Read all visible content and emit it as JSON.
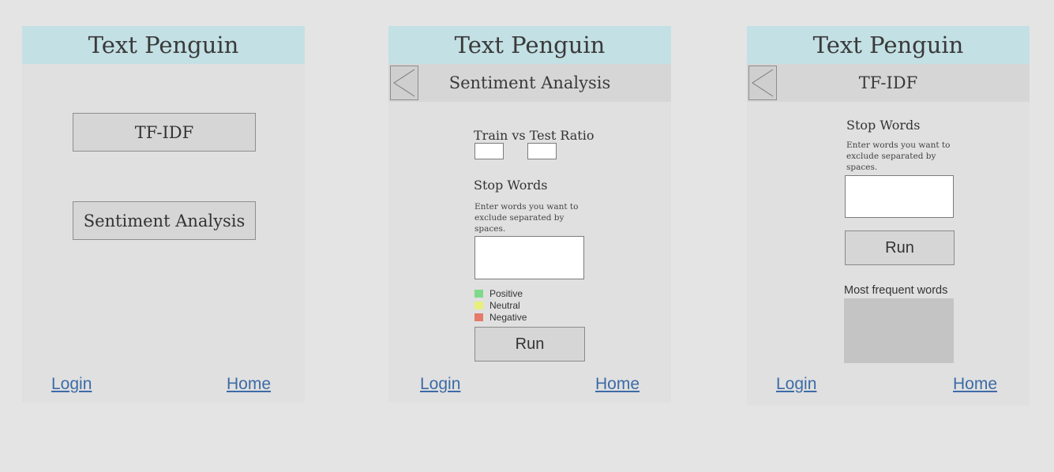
{
  "screens": [
    {
      "app_title": "Text Penguin",
      "buttons": [
        "TF-IDF",
        "Sentiment Analysis"
      ],
      "footer": {
        "login": "Login",
        "home": "Home"
      }
    },
    {
      "app_title": "Text Penguin",
      "subtitle": "Sentiment Analysis",
      "ratio_label": "Train vs Test Ratio",
      "stop_words_label": "Stop Words",
      "stop_words_help": "Enter words you want to exclude separated by spaces.",
      "legend": [
        {
          "label": "Positive",
          "color": "#7fd98a"
        },
        {
          "label": "Neutral",
          "color": "#e6f07a"
        },
        {
          "label": "Negative",
          "color": "#e47a6a"
        }
      ],
      "run_label": "Run",
      "footer": {
        "login": "Login",
        "home": "Home"
      }
    },
    {
      "app_title": "Text Penguin",
      "subtitle": "TF-IDF",
      "stop_words_label": "Stop Words",
      "stop_words_help": "Enter words you want to exclude separated by spaces.",
      "run_label": "Run",
      "results_label": "Most frequent words",
      "footer": {
        "login": "Login",
        "home": "Home"
      }
    }
  ],
  "colors": {
    "header_bg": "#c3e0e4",
    "link": "#3d6ba6",
    "panel_bg": "#e0e0e0",
    "page_bg": "#e4e4e4"
  }
}
